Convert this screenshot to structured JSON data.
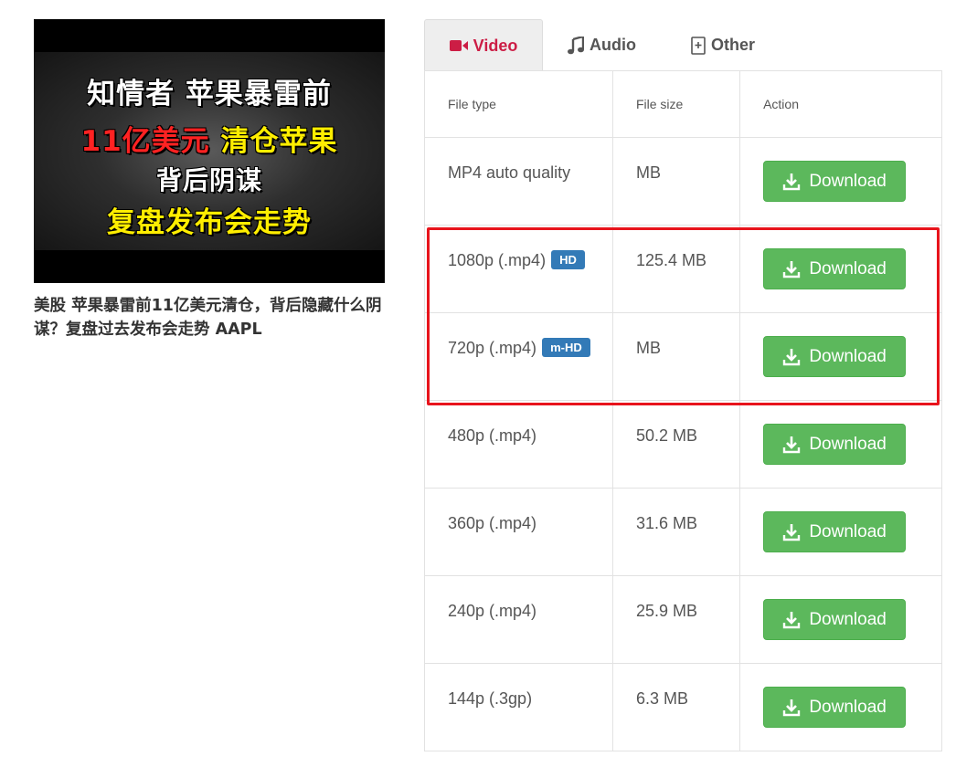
{
  "thumbnail": {
    "line1": "知情者 苹果暴雷前",
    "line2_red": "11亿美元",
    "line2_yellow": " 清仓苹果",
    "line3": "背后阴谋",
    "line4": "复盘发布会走势"
  },
  "video_title": "美股 苹果暴雷前11亿美元清仓，背后隐藏什么阴谋？复盘过去发布会走势 AAPL",
  "tabs": {
    "video": "Video",
    "audio": "Audio",
    "other": "Other"
  },
  "colors": {
    "active_tab": "#cc1d45",
    "download_button": "#5cb85c",
    "badge": "#337ab7",
    "highlight": "#e8141c"
  },
  "table": {
    "headers": {
      "file_type": "File type",
      "file_size": "File size",
      "action": "Action"
    },
    "rows": [
      {
        "type": "MP4 auto quality",
        "badge": null,
        "size": "MB",
        "action": "Download"
      },
      {
        "type": "1080p (.mp4)",
        "badge": "HD",
        "size": "125.4 MB",
        "action": "Download"
      },
      {
        "type": "720p (.mp4)",
        "badge": "m-HD",
        "size": "MB",
        "action": "Download"
      },
      {
        "type": "480p (.mp4)",
        "badge": null,
        "size": "50.2 MB",
        "action": "Download"
      },
      {
        "type": "360p (.mp4)",
        "badge": null,
        "size": "31.6 MB",
        "action": "Download"
      },
      {
        "type": "240p (.mp4)",
        "badge": null,
        "size": "25.9 MB",
        "action": "Download"
      },
      {
        "type": "144p (.3gp)",
        "badge": null,
        "size": "6.3 MB",
        "action": "Download"
      }
    ]
  }
}
